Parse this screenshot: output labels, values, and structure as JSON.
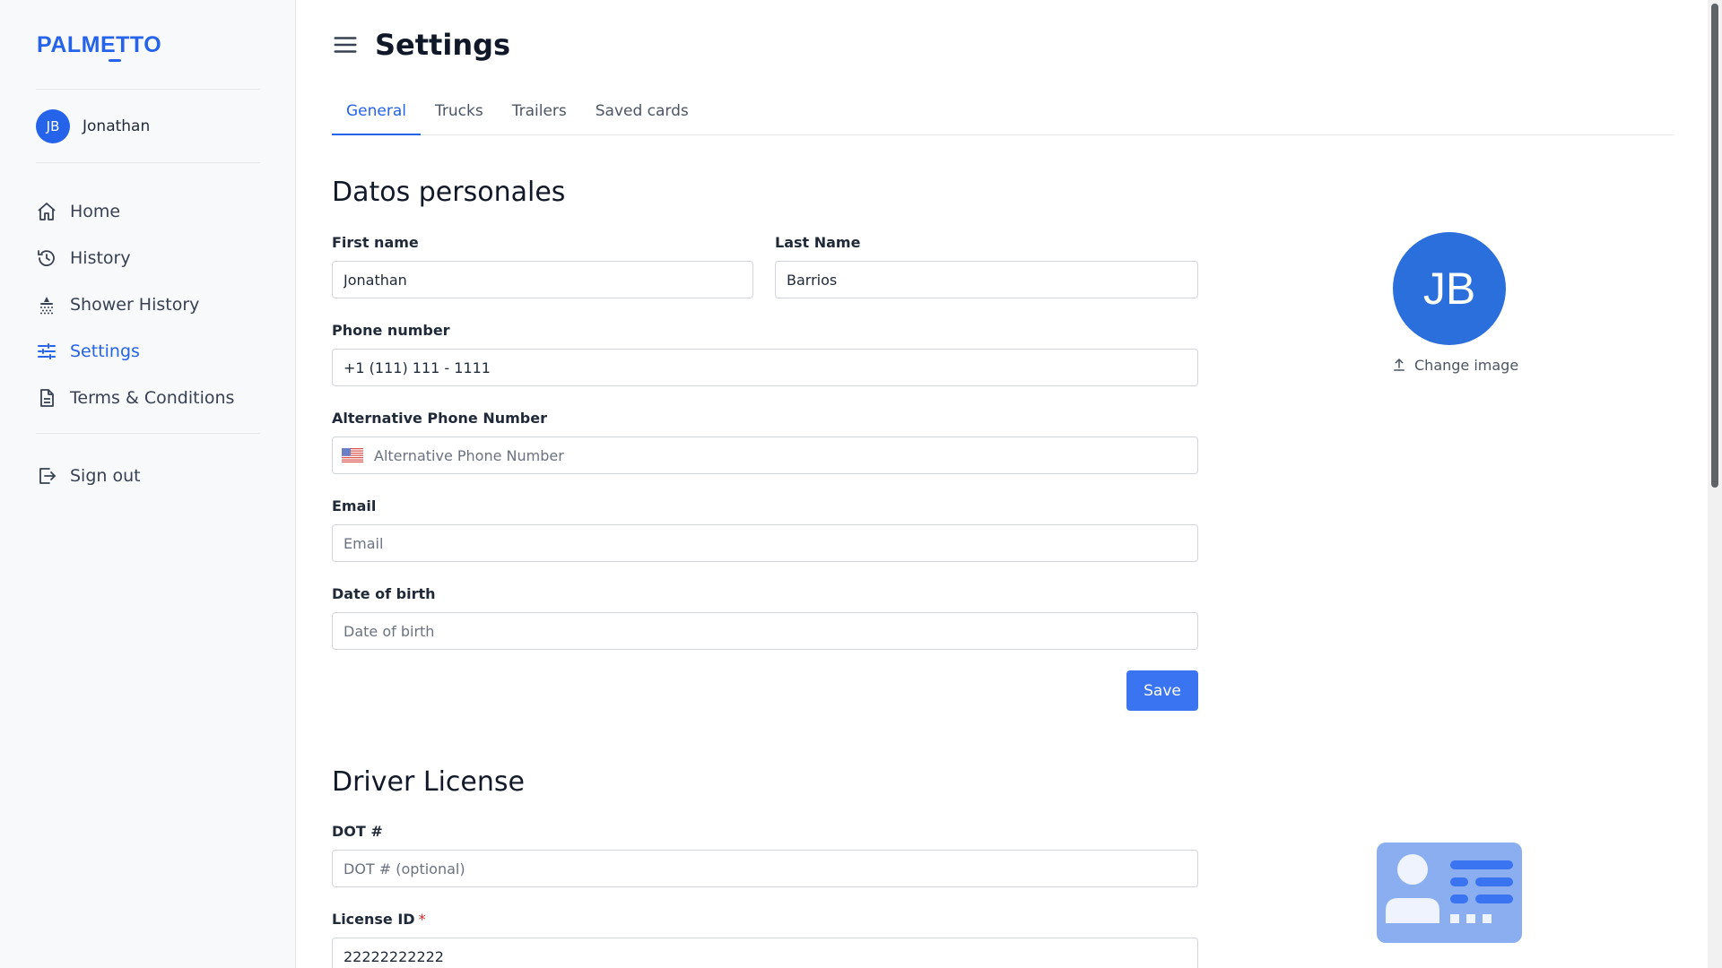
{
  "brand": {
    "logo_text": "PALMETTO",
    "accent_color": "#2563eb"
  },
  "user": {
    "initials": "JB",
    "name": "Jonathan"
  },
  "sidebar": {
    "items": [
      {
        "label": "Home",
        "icon": "home-icon",
        "active": false
      },
      {
        "label": "History",
        "icon": "history-icon",
        "active": false
      },
      {
        "label": "Shower History",
        "icon": "shower-icon",
        "active": false
      },
      {
        "label": "Settings",
        "icon": "sliders-icon",
        "active": true
      },
      {
        "label": "Terms & Conditions",
        "icon": "document-icon",
        "active": false
      }
    ],
    "signout_label": "Sign out"
  },
  "header": {
    "title": "Settings"
  },
  "tabs": [
    {
      "label": "General",
      "active": true
    },
    {
      "label": "Trucks",
      "active": false
    },
    {
      "label": "Trailers",
      "active": false
    },
    {
      "label": "Saved cards",
      "active": false
    }
  ],
  "personal": {
    "section_title": "Datos personales",
    "first_name": {
      "label": "First name",
      "value": "Jonathan"
    },
    "last_name": {
      "label": "Last Name",
      "value": "Barrios"
    },
    "phone": {
      "label": "Phone number",
      "value": "+1 (111) 111 - 1111"
    },
    "alt_phone": {
      "label": "Alternative Phone Number",
      "placeholder": "Alternative Phone Number"
    },
    "email": {
      "label": "Email",
      "placeholder": "Email"
    },
    "dob": {
      "label": "Date of birth",
      "placeholder": "Date of birth"
    },
    "save_label": "Save"
  },
  "profile_image": {
    "initials": "JB",
    "change_label": "Change image"
  },
  "license": {
    "section_title": "Driver License",
    "dot": {
      "label": "DOT #",
      "placeholder": "DOT # (optional)"
    },
    "license_id": {
      "label": "License ID",
      "required_mark": "*",
      "value": "22222222222"
    }
  }
}
